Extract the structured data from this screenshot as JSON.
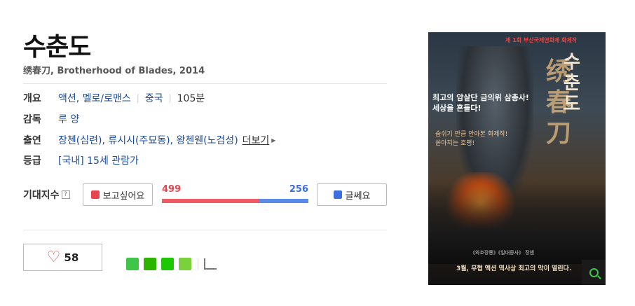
{
  "movie": {
    "title": "수춘도",
    "subtitle": "绣春刀, Brotherhood of Blades, 2014"
  },
  "info": {
    "overview": {
      "label": "개요",
      "genre": "액션, 멜로/로맨스",
      "country": "중국",
      "runtime": "105분"
    },
    "director": {
      "label": "감독",
      "name": "루 양"
    },
    "cast": {
      "label": "출연",
      "members": "장첸(심련), 류시시(주묘동), 왕첸웬(노검성)",
      "more": "더보기"
    },
    "rating": {
      "label": "등급",
      "value": "[국내] 15세 관람가"
    }
  },
  "expectation": {
    "label": "기대지수",
    "help": "?",
    "want_label": "보고싶어요",
    "nah_label": "글쎄요",
    "want_count": "499",
    "nah_count": "256",
    "want_fraction": 0.661
  },
  "like": {
    "count": "58"
  },
  "share_icons": [
    "blog-icon",
    "cafe-icon",
    "bookmark-icon",
    "memo-icon",
    "share-icon"
  ],
  "poster": {
    "top_text": "제 1회 부산국제영화제 화제작",
    "title_ko_1": "수",
    "title_ko_2": "춘",
    "title_ko_3": "도",
    "title_han_1": "绣",
    "title_han_2": "春",
    "title_han_3": "刀",
    "tagline_1": "최고의 암살단 금의위 삼총사!",
    "tagline_2": "세상을 흔들다!",
    "sub_1": "숨쉬기 만큼 안아본 화제작!",
    "sub_2": "쏟아지는 호평!",
    "credit": "《와호장룡》《일대종사》 장첸",
    "bottom": "3월, 무협 액션 역사상 최고의 막이 열린다."
  },
  "colors": {
    "want": "#e8454f",
    "nah": "#3b6fe0",
    "link": "#1a4b9c"
  }
}
